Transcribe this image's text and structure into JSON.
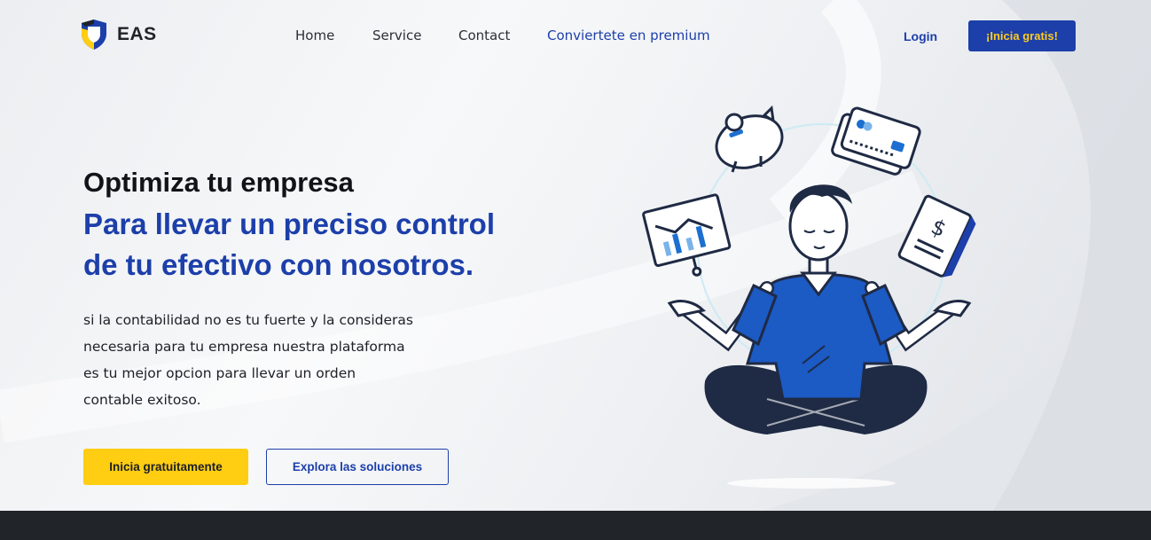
{
  "brand": {
    "name": "EAS",
    "colors": {
      "primary": "#1c3faa",
      "accent": "#ffcd12",
      "dark": "#212428"
    }
  },
  "nav": {
    "links": [
      "Home",
      "Service",
      "Contact",
      "Conviertete en premium"
    ],
    "login": "Login",
    "cta": "¡Inicia gratis!"
  },
  "hero": {
    "headline": "Optimiza tu empresa",
    "subheadline_line1": "Para llevar un preciso control",
    "subheadline_line2": "de tu efectivo con nosotros.",
    "description_lines": [
      "si la contabilidad no es tu fuerte y la consideras",
      "necesaria para tu empresa nuestra plataforma",
      "es tu mejor opcion para llevar un orden",
      "contable exitoso."
    ],
    "primary_button": "Inicia gratuitamente",
    "secondary_button": "Explora las soluciones"
  },
  "illustration": {
    "icons": [
      "piggy-bank-icon",
      "credit-card-icon",
      "chart-board-icon",
      "invoice-icon",
      "meditating-person"
    ]
  }
}
